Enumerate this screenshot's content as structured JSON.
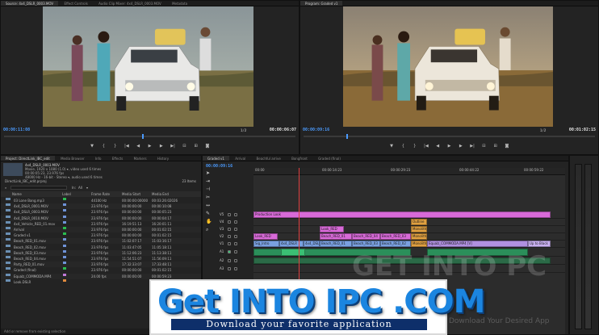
{
  "source_monitor": {
    "tabs": [
      "Source: 4x4_DSLR_0003.MOV",
      "Effect Controls",
      "Audio Clip Mixer: 4x4_DSLR_0003.MOV",
      "Metadata"
    ],
    "timecode_in": "00:00:11:08",
    "timecode_duration": "00:00:06:07",
    "zoom": "1/2"
  },
  "program_monitor": {
    "tabs": [
      "Program: Graded v1"
    ],
    "timecode_in": "00:00:09:16",
    "timecode_duration": "00:01:02:15",
    "zoom": "1/2"
  },
  "project_panel": {
    "tabs": [
      "Project: DirectLink_IBC_edit",
      "Media Browser",
      "Info",
      "Effects",
      "Markers",
      "History"
    ],
    "clip_name": "4x4_DSLR_0003.MOV",
    "clip_meta": [
      "Movie, 1920 x 1080 (1.0)  ▾, video used 6 times",
      "00:00:05:23, 23.976 fps",
      "48000 Hz - 16-bit - Stereo  ▾, audio used 6 times"
    ],
    "project_file": "DirectLink_IBC_edit.prproj",
    "item_count": "23 Items",
    "search_label": "In:",
    "search_value": "All",
    "columns": [
      "Name",
      "Label",
      "Frame Rate",
      "Media Start",
      "Media End"
    ],
    "rows": [
      {
        "name": "03 Lone Bang.mp3",
        "label_color": "#2bbd4f",
        "rate": "44100 Hz",
        "start": "00:00:00:00000",
        "end": "00:03:26:02026"
      },
      {
        "name": "4x4_DSLR_0001.MOV",
        "label_color": "#6f93d8",
        "rate": "23.976 fps",
        "start": "00:00:00:00",
        "end": "00:00:10:08"
      },
      {
        "name": "4x4_DSLR_0003.MOV",
        "label_color": "#6f93d8",
        "rate": "23.976 fps",
        "start": "00:00:00:00",
        "end": "00:00:05:23"
      },
      {
        "name": "4x4_DSLR_0010.MOV",
        "label_color": "#6f93d8",
        "rate": "23.976 fps",
        "start": "00:00:00:00",
        "end": "00:00:04:17"
      },
      {
        "name": "4x4_Vehicle_RED_01.mov",
        "label_color": "#6f93d8",
        "rate": "23.976 fps",
        "start": "16:19:51:13",
        "end": "16:20:01:11"
      },
      {
        "name": "Arrival",
        "label_color": "#2bbd4f",
        "rate": "23.976 fps",
        "start": "00:00:00:00",
        "end": "00:01:02:15"
      },
      {
        "name": "Graded v1",
        "label_color": "#2bbd4f",
        "rate": "23.976 fps",
        "start": "00:00:00:00",
        "end": "00:01:02:15"
      },
      {
        "name": "Beach_RED_01.mov",
        "label_color": "#6f93d8",
        "rate": "23.976 fps",
        "start": "11:02:07:17",
        "end": "11:03:16:17"
      },
      {
        "name": "Beach_RED_02.mov",
        "label_color": "#6f93d8",
        "rate": "23.976 fps",
        "start": "11:03:47:05",
        "end": "11:05:18:11"
      },
      {
        "name": "Beach_RED_03.mov",
        "label_color": "#6f93d8",
        "rate": "23.976 fps",
        "start": "11:12:06:23",
        "end": "11:13:38:11"
      },
      {
        "name": "Beach_RED_04.mov",
        "label_color": "#6f93d8",
        "rate": "23.976 fps",
        "start": "11:54:51:07",
        "end": "11:56:09:11"
      },
      {
        "name": "Party_RED_01.mov",
        "label_color": "#6f93d8",
        "rate": "23.976 fps",
        "start": "17:32:33:07",
        "end": "17:33:48:11"
      },
      {
        "name": "Graded (final)",
        "label_color": "#2bbd4f",
        "rate": "23.976 fps",
        "start": "00:00:00:00",
        "end": "00:01:02:15"
      },
      {
        "name": "Equalz_COMMODA.MP4",
        "label_color": "#c07ad8",
        "rate": "24.00 fps",
        "start": "00:00:00:00",
        "end": "00:00:59:23"
      },
      {
        "name": "Look.DSLR",
        "label_color": "#e08a3d",
        "rate": "",
        "start": "",
        "end": ""
      }
    ],
    "status": "Add or remove from existing selection"
  },
  "timeline": {
    "tabs": [
      "Graded v1",
      "Arrival",
      "Beachful arrive",
      "Bongfront",
      "Graded (final)"
    ],
    "timecode": "00:00:09:16",
    "ruler_marks": [
      "00:00",
      "00:00:14:23",
      "00:00:29:23",
      "00:00:44:22",
      "00:00:59:22"
    ],
    "video_tracks": [
      "V5",
      "V4",
      "V3",
      "V2",
      "V1"
    ],
    "audio_tracks": [
      "A1",
      "A2",
      "A3"
    ],
    "clips": {
      "v5": [
        {
          "label": "Production Look",
          "color": "#d86ad8"
        }
      ],
      "v4": [
        {
          "label": "Outline",
          "color": "#e0a040"
        }
      ],
      "v3": [
        {
          "label": "Look_RED",
          "color": "#d86ad8"
        },
        {
          "label": "Monolith",
          "color": "#e0a040"
        }
      ],
      "v2": [
        {
          "label": "Look_RED",
          "color": "#d86ad8"
        },
        {
          "label": "Beach_RED_01",
          "color": "#d86ad8"
        },
        {
          "label": "Beach_RED_04",
          "color": "#d86ad8"
        },
        {
          "label": "Beach_RED_03",
          "color": "#d86ad8"
        },
        {
          "label": "Monolith",
          "color": "#e0a040"
        }
      ],
      "v1": [
        {
          "label": "Sig_Intro",
          "color": "#7aa0e0"
        },
        {
          "label": "4x4_DSLR",
          "color": "#7aa0e0"
        },
        {
          "label": "4x4_DSLR_0",
          "color": "#7aa0e0"
        },
        {
          "label": "Beach_RED_01",
          "color": "#7aa0e0"
        },
        {
          "label": "Beach_RED_03",
          "color": "#7aa0e0"
        },
        {
          "label": "Beach_RED_02",
          "color": "#7aa0e0"
        },
        {
          "label": "Monolith",
          "color": "#e0a040"
        },
        {
          "label": "Equalz_COMMODA.MP4 [V]",
          "color": "#b090e0"
        },
        {
          "label": "Up to Black",
          "color": "#c8b0f0"
        }
      ]
    }
  },
  "ad": {
    "title": "Get INTO IPC .COM",
    "subtitle": "Download your favorite application",
    "watermark": "GET INTO PC",
    "watermark_sub": "Download Your Desired App"
  }
}
